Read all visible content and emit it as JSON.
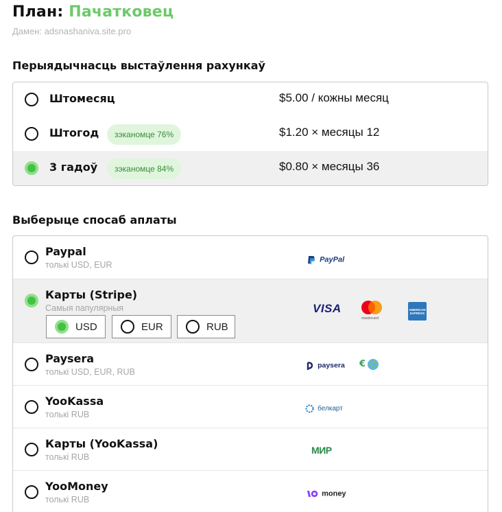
{
  "plan": {
    "prefix": "План:",
    "name": "Пачатковец"
  },
  "domain_line": "Дамен: adsnashaniva.site.pro",
  "billing": {
    "title": "Перыядычнасць выстаўлення рахункаў",
    "options": [
      {
        "label": "Штомесяц",
        "savings": "",
        "price": "$5.00 / кожны месяц",
        "selected": false
      },
      {
        "label": "Штогод",
        "savings": "зэканомце 76%",
        "price": "$1.20 × месяцы 12",
        "selected": false
      },
      {
        "label": "3 гадоў",
        "savings": "зэканомце 84%",
        "price": "$0.80 × месяцы 36",
        "selected": true
      }
    ]
  },
  "payment": {
    "title": "Выберыце спосаб аплаты",
    "methods": [
      {
        "name": "Paypal",
        "sub": "толькі USD, EUR",
        "logos": [
          "paypal-logo"
        ],
        "selected": false
      },
      {
        "name": "Карты (Stripe)",
        "sub": "Самыя папулярныя",
        "logos": [
          "visa-logo",
          "mastercard-logo",
          "amex-logo"
        ],
        "selected": true
      },
      {
        "name": "Paysera",
        "sub": "толькі USD, EUR, RUB",
        "logos": [
          "paysera-logo",
          "euro-globe-logo"
        ],
        "selected": false
      },
      {
        "name": "YooKassa",
        "sub": "толькі RUB",
        "logos": [
          "belkart-logo"
        ],
        "selected": false
      },
      {
        "name": "Карты (YooKassa)",
        "sub": "толькі RUB",
        "logos": [
          "mir-logo"
        ],
        "selected": false
      },
      {
        "name": "YooMoney",
        "sub": "толькі RUB",
        "logos": [
          "yoomoney-logo"
        ],
        "selected": false
      }
    ],
    "currencies": [
      {
        "code": "USD",
        "selected": true
      },
      {
        "code": "EUR",
        "selected": false
      },
      {
        "code": "RUB",
        "selected": false
      }
    ]
  },
  "logo_texts": {
    "paypal": "PayPal",
    "visa": "VISA",
    "mastercard": "mastercard",
    "amex_top": "AMERICAN",
    "amex_bottom": "EXPRESS",
    "paysera": "paysera",
    "belkart": "белкарт",
    "mir": "МИР",
    "yoomoney": "money"
  },
  "colors": {
    "accent_green": "#6cc96a",
    "radio_selected": "#45c043",
    "savings_bg": "#dff6dd",
    "row_selected_bg": "#f0f0f0"
  }
}
